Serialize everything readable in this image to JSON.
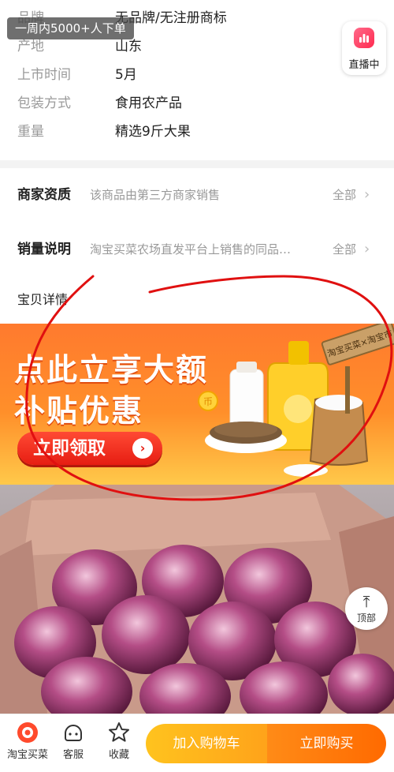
{
  "specs": [
    {
      "label": "品牌",
      "value": "无品牌/无注册商标"
    },
    {
      "label": "产地",
      "value": "山东"
    },
    {
      "label": "上市时间",
      "value": "5月"
    },
    {
      "label": "包装方式",
      "value": "食用农产品"
    },
    {
      "label": "重量",
      "value": "精选9斤大果"
    }
  ],
  "toast": "一周内5000+人下单",
  "live_button": {
    "label": "直播中"
  },
  "info_rows": [
    {
      "title": "商家资质",
      "desc": "该商品由第三方商家销售",
      "more": "全部"
    },
    {
      "title": "销量说明",
      "desc": "淘宝买菜农场直发平台上销售的同品…",
      "more": "全部"
    }
  ],
  "detail_title": "宝贝详情",
  "banner": {
    "line1": "点此立享大额",
    "line2": "补贴优惠",
    "button": "立即领取",
    "sign_text": "淘宝买菜×淘宝市",
    "coin_text": "币"
  },
  "back_to_top": {
    "label": "顶部"
  },
  "bottom_bar": {
    "nav": [
      {
        "label": "淘宝买菜",
        "icon": "store-logo-icon"
      },
      {
        "label": "客服",
        "icon": "customer-service-icon"
      },
      {
        "label": "收藏",
        "icon": "star-icon"
      }
    ],
    "add_to_cart": "加入购物车",
    "buy_now": "立即购买"
  },
  "colors": {
    "accent_orange": "#ff6a00",
    "cart_yellow": "#ffb21a",
    "banner_orange": "#ff7a2e",
    "annotation_red": "#e01010"
  }
}
